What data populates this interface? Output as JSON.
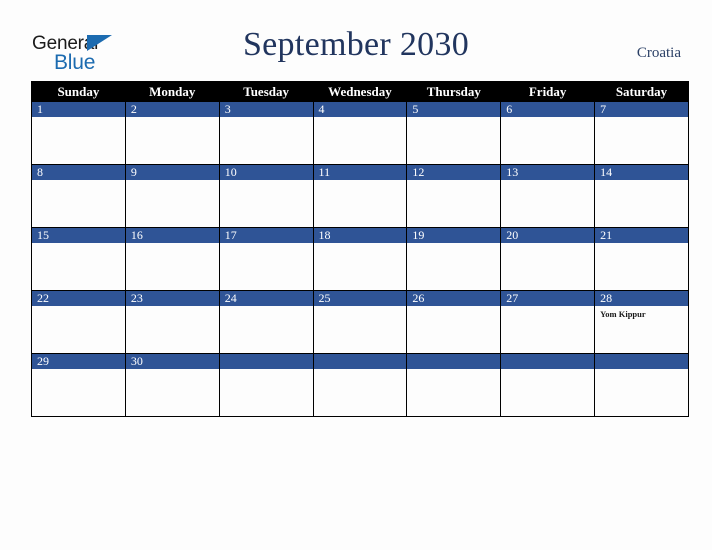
{
  "logo": {
    "line1": "General",
    "line2": "Blue",
    "triangle_color": "#1c6bb0",
    "text_color": "#1b1b1b"
  },
  "header": {
    "title": "September 2030",
    "country": "Croatia",
    "title_color": "#21355e"
  },
  "calendar": {
    "weekday_headers": [
      "Sunday",
      "Monday",
      "Tuesday",
      "Wednesday",
      "Thursday",
      "Friday",
      "Saturday"
    ],
    "header_bg": "#000000",
    "daynum_bg": "#2f5496",
    "cell_bg": "#fdfdfd",
    "weeks": [
      [
        {
          "day": "1",
          "events": []
        },
        {
          "day": "2",
          "events": []
        },
        {
          "day": "3",
          "events": []
        },
        {
          "day": "4",
          "events": []
        },
        {
          "day": "5",
          "events": []
        },
        {
          "day": "6",
          "events": []
        },
        {
          "day": "7",
          "events": []
        }
      ],
      [
        {
          "day": "8",
          "events": []
        },
        {
          "day": "9",
          "events": []
        },
        {
          "day": "10",
          "events": []
        },
        {
          "day": "11",
          "events": []
        },
        {
          "day": "12",
          "events": []
        },
        {
          "day": "13",
          "events": []
        },
        {
          "day": "14",
          "events": []
        }
      ],
      [
        {
          "day": "15",
          "events": []
        },
        {
          "day": "16",
          "events": []
        },
        {
          "day": "17",
          "events": []
        },
        {
          "day": "18",
          "events": []
        },
        {
          "day": "19",
          "events": []
        },
        {
          "day": "20",
          "events": []
        },
        {
          "day": "21",
          "events": []
        }
      ],
      [
        {
          "day": "22",
          "events": []
        },
        {
          "day": "23",
          "events": []
        },
        {
          "day": "24",
          "events": []
        },
        {
          "day": "25",
          "events": []
        },
        {
          "day": "26",
          "events": []
        },
        {
          "day": "27",
          "events": []
        },
        {
          "day": "28",
          "events": [
            "Yom Kippur"
          ]
        }
      ],
      [
        {
          "day": "29",
          "events": []
        },
        {
          "day": "30",
          "events": []
        },
        {
          "day": "",
          "events": []
        },
        {
          "day": "",
          "events": []
        },
        {
          "day": "",
          "events": []
        },
        {
          "day": "",
          "events": []
        },
        {
          "day": "",
          "events": []
        }
      ]
    ]
  }
}
